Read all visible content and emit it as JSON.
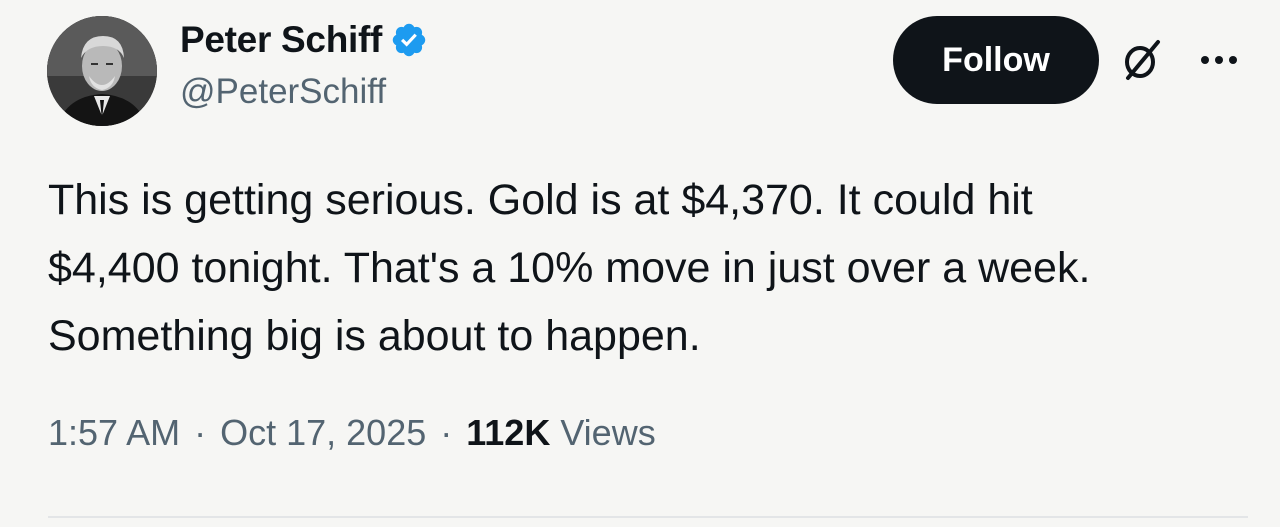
{
  "author": {
    "display_name": "Peter Schiff",
    "handle": "@PeterSchiff",
    "verified": true
  },
  "actions": {
    "follow_label": "Follow",
    "grok_icon": "grok-icon",
    "more_icon": "more-options-icon"
  },
  "tweet": {
    "lines": [
      "This is getting serious. Gold is at $4,370. It could hit",
      "$4,400 tonight. That's a 10% move in just over a week.",
      "Something big is about to happen."
    ]
  },
  "meta": {
    "time": "1:57 AM",
    "separator": "·",
    "date": "Oct 17, 2025",
    "views_count": "112K",
    "views_label": "Views"
  },
  "colors": {
    "background": "#f6f6f4",
    "text": "#0f1419",
    "secondary_text": "#536471",
    "verified_badge": "#1d9bf0",
    "button_bg": "#0f1419"
  }
}
